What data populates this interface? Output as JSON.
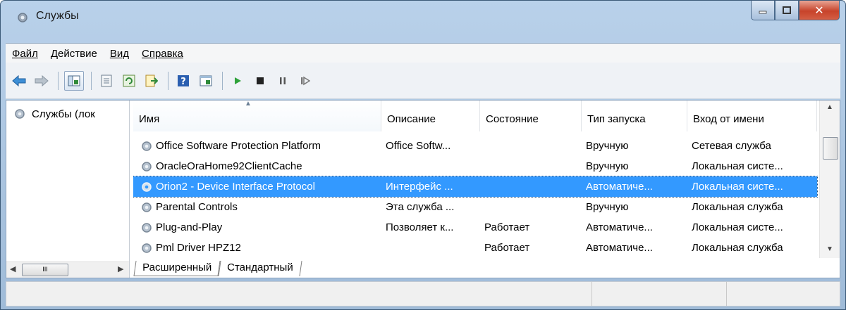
{
  "window": {
    "title": "Службы"
  },
  "menu": [
    {
      "label": "Файл"
    },
    {
      "label": "Действие"
    },
    {
      "label": "Вид"
    },
    {
      "label": "Справка"
    }
  ],
  "tree": {
    "item": "Службы (лок"
  },
  "table": {
    "columns": [
      "Имя",
      "Описание",
      "Состояние",
      "Тип запуска",
      "Вход от имени"
    ],
    "rows": [
      {
        "name": "Office Software Protection Platform",
        "description": "Office Softw...",
        "state": "",
        "startup": "Вручную",
        "logon": "Сетевая служба"
      },
      {
        "name": "OracleOraHome92ClientCache",
        "description": "",
        "state": "",
        "startup": "Вручную",
        "logon": "Локальная систе..."
      },
      {
        "name": "Orion2 - Device Interface Protocol",
        "description": "Интерфейс ...",
        "state": "",
        "startup": "Автоматиче...",
        "logon": "Локальная систе..."
      },
      {
        "name": "Parental Controls",
        "description": "Эта служба ...",
        "state": "",
        "startup": "Вручную",
        "logon": "Локальная служба"
      },
      {
        "name": "Plug-and-Play",
        "description": "Позволяет к...",
        "state": "Работает",
        "startup": "Автоматиче...",
        "logon": "Локальная систе..."
      },
      {
        "name": "Pml Driver HPZ12",
        "description": "",
        "state": "Работает",
        "startup": "Автоматиче...",
        "logon": "Локальная служба"
      }
    ],
    "selected_row_index": 2
  },
  "tabs": [
    {
      "label": "Расширенный"
    },
    {
      "label": "Стандартный"
    }
  ],
  "scrollbar": {
    "h_thumb_label": "III"
  },
  "colors": {
    "selection": "#3399ff",
    "title_gradient": "#b9d1ea",
    "close_button": "#c7432a"
  }
}
